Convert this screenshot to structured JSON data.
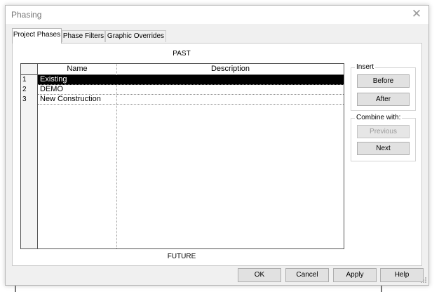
{
  "window": {
    "title": "Phasing"
  },
  "tabs": [
    {
      "label": "Project Phases",
      "active": true
    },
    {
      "label": "Phase Filters",
      "active": false
    },
    {
      "label": "Graphic Overrides",
      "active": false
    }
  ],
  "phases_table": {
    "top_label": "PAST",
    "bottom_label": "FUTURE",
    "columns": [
      "Name",
      "Description"
    ],
    "rows": [
      {
        "num": "1",
        "name": "Existing",
        "description": "",
        "selected": true
      },
      {
        "num": "2",
        "name": "DEMO",
        "description": ""
      },
      {
        "num": "3",
        "name": "New Construction",
        "description": ""
      }
    ]
  },
  "insert_group": {
    "label": "Insert",
    "before": "Before",
    "after": "After"
  },
  "combine_group": {
    "label": "Combine with:",
    "previous": "Previous",
    "next": "Next",
    "previous_enabled": false
  },
  "footer": {
    "ok": "OK",
    "cancel": "Cancel",
    "apply": "Apply",
    "help": "Help"
  },
  "icons": {
    "close": "close-icon",
    "resize": "resize-grip-icon"
  },
  "colors": {
    "selection": "#000000",
    "dialog_bg": "#f0f0f0"
  }
}
